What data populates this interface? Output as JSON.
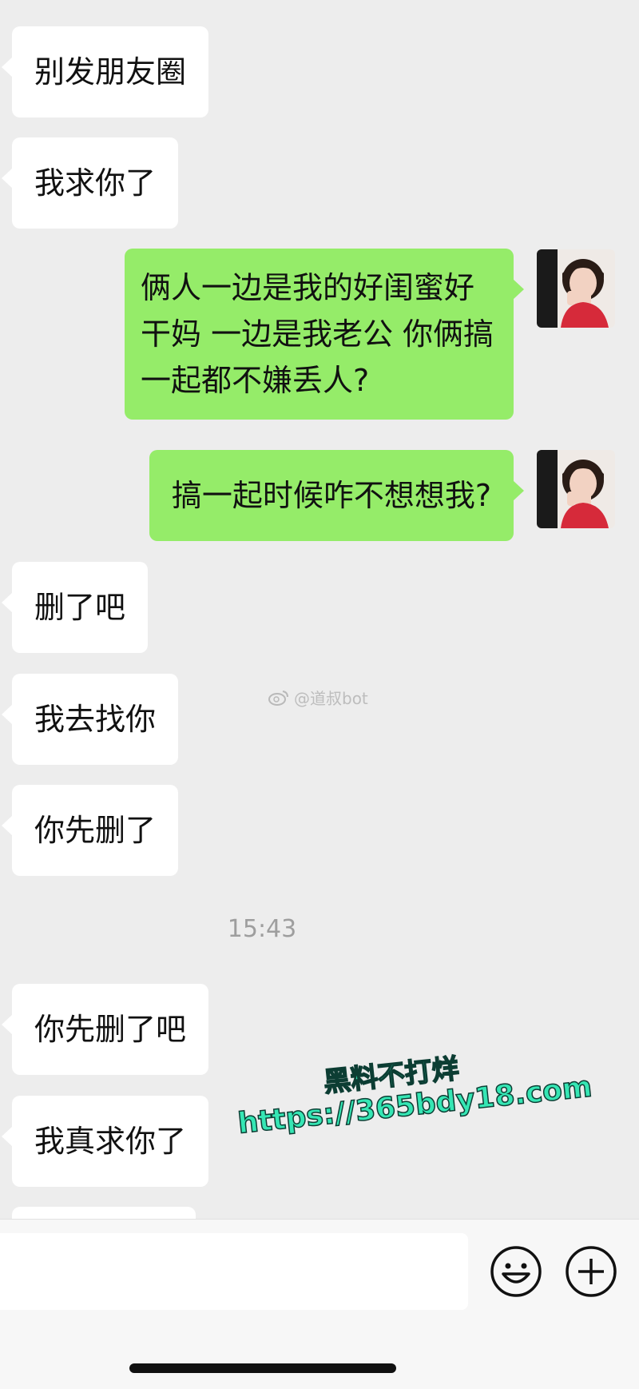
{
  "messages": [
    {
      "side": "left",
      "text": "别发朋友圈"
    },
    {
      "side": "left",
      "text": "我求你了"
    },
    {
      "side": "right",
      "text": "俩人一边是我的好闺蜜好干妈 一边是我老公 你俩搞一起都不嫌丢人?"
    },
    {
      "side": "right",
      "text": "搞一起时候咋不想想我?"
    },
    {
      "side": "left",
      "text": "删了吧"
    },
    {
      "side": "left",
      "text": "我去找你"
    },
    {
      "side": "left",
      "text": "你先删了"
    },
    {
      "side": "left",
      "text": "你先删了吧"
    },
    {
      "side": "left",
      "text": "我真求你了"
    }
  ],
  "timestamp": "15:43",
  "watermark": "@道叔bot",
  "promo": {
    "line1": "黑料不打烊",
    "line2": "https://365bdy18.com",
    "color": "#35e6b4"
  },
  "input": {
    "value": ""
  },
  "icons": {
    "emoji": "emoji-face-icon",
    "plus": "plus-circle-icon",
    "weibo": "weibo-logo-icon"
  },
  "colors": {
    "background": "#ededed",
    "incoming_bubble": "#ffffff",
    "outgoing_bubble": "#95ec69"
  }
}
